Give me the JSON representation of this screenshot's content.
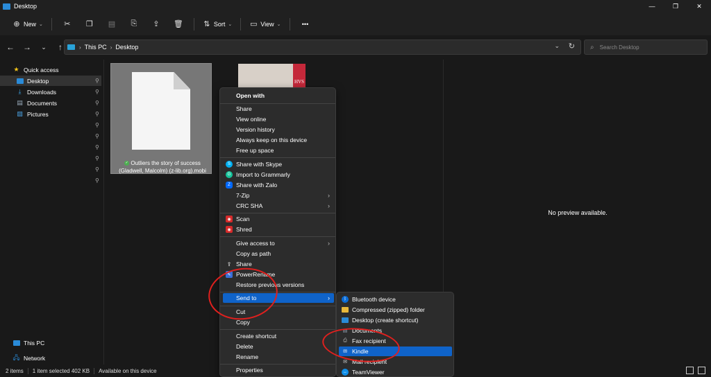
{
  "window": {
    "title": "Desktop",
    "minimize": "—",
    "maximize": "❐",
    "close": "✕"
  },
  "toolbar": {
    "new_label": "New",
    "sort_label": "Sort",
    "view_label": "View",
    "more": "•••"
  },
  "address": {
    "crumbs": [
      "This PC",
      "Desktop"
    ],
    "search_placeholder": "Search Desktop"
  },
  "sidebar": {
    "items": [
      {
        "label": "Quick access",
        "icon": "star-icon",
        "color": "#f5c518"
      },
      {
        "label": "Desktop",
        "icon": "desktop-folder-icon",
        "color": "#2a8bd8"
      },
      {
        "label": "Downloads",
        "icon": "downloads-icon",
        "color": "#3aa0e0"
      },
      {
        "label": "Documents",
        "icon": "documents-icon",
        "color": "#9ab"
      },
      {
        "label": "Pictures",
        "icon": "pictures-icon",
        "color": "#4aa0e0"
      },
      {
        "label": "This PC",
        "icon": "pc-icon",
        "color": "#2a8bd8"
      },
      {
        "label": "Network",
        "icon": "network-icon",
        "color": "#2a8bd8"
      }
    ]
  },
  "files": {
    "selected_name": "Outliers the story of success (Gladwell, Malcolm) (z-lib.org).mobi",
    "book_label": "HVS"
  },
  "preview": {
    "message": "No preview available."
  },
  "status": {
    "items_count": "2 items",
    "selected": "1 item selected  402 KB",
    "availability": "Available on this device"
  },
  "context_menu": {
    "open_with": "Open with",
    "share": "Share",
    "view_online": "View online",
    "version_history": "Version history",
    "always_keep": "Always keep on this device",
    "free_up": "Free up space",
    "share_skype": "Share with Skype",
    "import_grammarly": "Import to Grammarly",
    "share_zalo": "Share with Zalo",
    "seven_zip": "7-Zip",
    "crc_sha": "CRC SHA",
    "scan": "Scan",
    "shred": "Shred",
    "give_access": "Give access to",
    "copy_path": "Copy as path",
    "share2": "Share",
    "power_rename": "PowerRename",
    "restore_prev": "Restore previous versions",
    "send_to": "Send to",
    "cut": "Cut",
    "copy": "Copy",
    "create_shortcut": "Create shortcut",
    "delete": "Delete",
    "rename": "Rename",
    "properties": "Properties"
  },
  "send_to_menu": {
    "bluetooth": "Bluetooth device",
    "compressed": "Compressed (zipped) folder",
    "desktop_shortcut": "Desktop (create shortcut)",
    "documents": "Documents",
    "fax": "Fax recipient",
    "kindle": "Kindle",
    "mail": "Mail recipient",
    "teamviewer": "TeamViewer"
  },
  "colors": {
    "highlight": "#0f63c9",
    "annotation": "#e0201e"
  }
}
